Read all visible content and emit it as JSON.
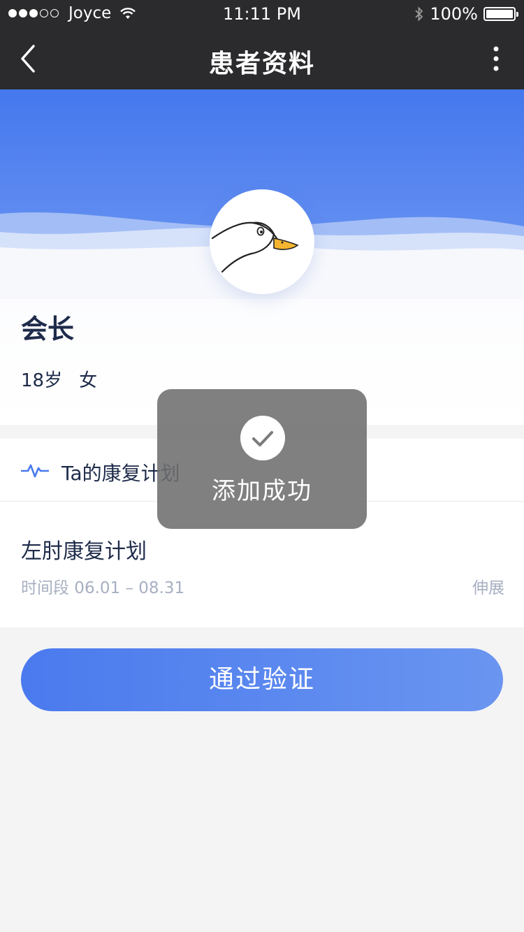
{
  "status_bar": {
    "carrier": "Joyce",
    "time": "11:11 PM",
    "battery": "100%",
    "signal_icon": "signal-dots-icon",
    "wifi_icon": "wifi-icon",
    "bluetooth_icon": "bluetooth-icon",
    "battery_icon": "battery-icon"
  },
  "nav": {
    "title": "患者资料",
    "back_icon": "chevron-left-icon",
    "more_icon": "more-vertical-icon"
  },
  "colors": {
    "nav_bg": "#2b2b2d",
    "banner_blue": "#4a7aee",
    "text_primary": "#1e2b4a",
    "text_secondary": "#a7afc1",
    "page_bg": "#f4f4f5"
  },
  "patient": {
    "name": "会长",
    "age": "18岁",
    "gender": "女",
    "avatar_icon": "duck-avatar-icon"
  },
  "plan": {
    "header_icon": "pulse-icon",
    "header_label": "Ta的康复计划",
    "title": "左肘康复计划",
    "period": "时间段 06.01 – 08.31",
    "type": "伸展"
  },
  "actions": {
    "verify_label": "通过验证"
  },
  "toast": {
    "icon": "check-icon",
    "message": "添加成功"
  }
}
